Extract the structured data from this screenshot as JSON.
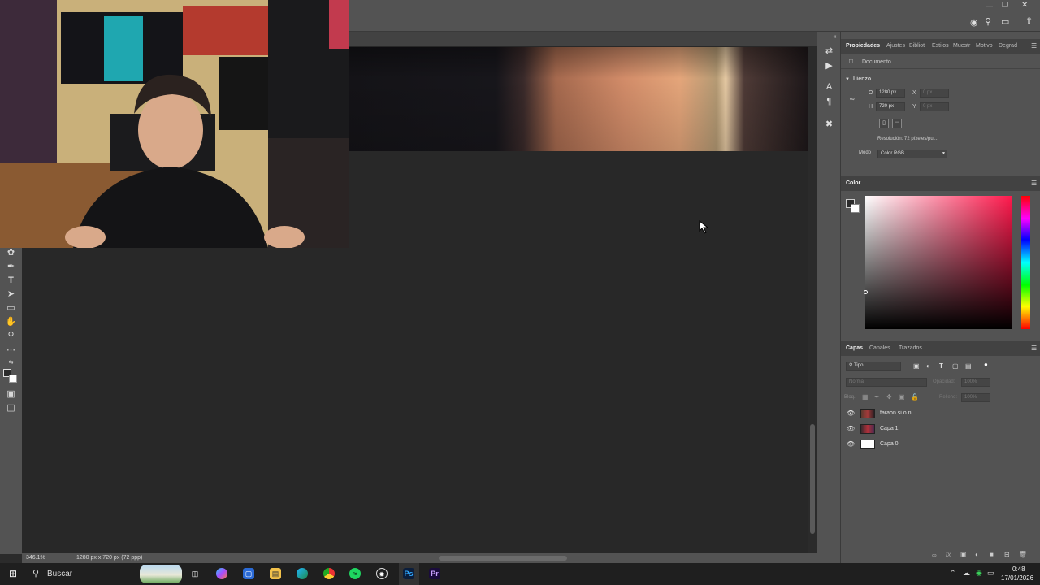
{
  "colors": {
    "ui_panel": "#535353",
    "ui_dark": "#282828",
    "color_field_hue": "#ff1a4d",
    "ps_icon": "#0b1e3c",
    "pr_icon": "#1a0b3c"
  },
  "properties_panel": {
    "tabs": [
      "Propiedades",
      "Ajustes",
      "Bibliot",
      "Estilos",
      "Muestr",
      "Motivo",
      "Degrad"
    ],
    "section_doc": "Documento",
    "section_canvas": "Lienzo",
    "width_label": "O",
    "width_value": "1280 px",
    "height_label": "H",
    "height_value": "720 px",
    "x_label": "X",
    "x_value": "0 px",
    "y_label": "Y",
    "y_value": "0 px",
    "resolution": "Resolución: 72 píxeles/pul...",
    "mode_label": "Modo",
    "mode_value": "Color RGB"
  },
  "color_panel": {
    "title": "Color"
  },
  "layers_panel": {
    "tabs": [
      "Capas",
      "Canales",
      "Trazados"
    ],
    "filter_label": "Tipo",
    "blend_mode": "Normal",
    "opacity_label": "Opacidad:",
    "opacity_value": "100%",
    "lock_label": "Bloq.:",
    "fill_label": "Relleno:",
    "fill_value": "100%",
    "layers": [
      {
        "name": "faraon si o ni"
      },
      {
        "name": "Capa 1"
      },
      {
        "name": "Capa 0"
      }
    ]
  },
  "status_bar": {
    "zoom": "346.1%",
    "doc_info": "1280 px x 720 px (72 ppp)"
  },
  "taskbar": {
    "search_placeholder": "Buscar",
    "ps_label": "Ps",
    "pr_label": "Pr",
    "time": "0:48",
    "date": "17/01/2026"
  },
  "icons": [
    "windows-start-icon",
    "search-icon",
    "task-view-icon",
    "copilot-icon",
    "store-icon",
    "file-explorer-icon",
    "edge-icon",
    "chrome-icon",
    "spotify-icon",
    "gear-app-icon",
    "photoshop-icon",
    "premiere-icon"
  ]
}
